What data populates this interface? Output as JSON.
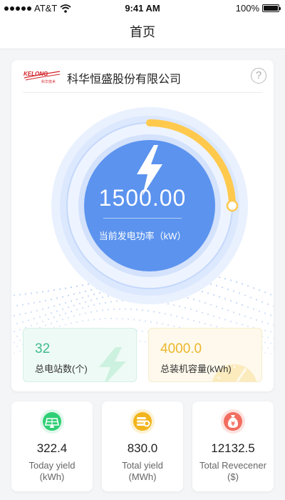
{
  "status_bar": {
    "carrier": "AT&T",
    "time": "9:41 AM",
    "battery": "100%",
    "battery_level": 1.0
  },
  "nav": {
    "title": "首页"
  },
  "company": {
    "name": "科华恒盛股份有限公司",
    "logo_text": "KELONG",
    "logo_subtext": "科华技术",
    "help_symbol": "?"
  },
  "power": {
    "value": "1500.00",
    "label": "当前发电功率（kW）",
    "gauge_level": 0.25
  },
  "stats": {
    "stations_value": "32",
    "stations_label": "总电站数(个)",
    "capacity_value": "4000.0",
    "capacity_label": "总装机容量(kWh)"
  },
  "cards": [
    {
      "value": "322.4",
      "label_line1": "Today yield",
      "label_line2": "(kWh)",
      "icon": "solar-panel-icon",
      "color": "#2fcf75"
    },
    {
      "value": "830.0",
      "label_line1": "Total yield",
      "label_line2": "(MWh)",
      "icon": "coin-stack-icon",
      "color": "#f2b51d"
    },
    {
      "value": "12132.5",
      "label_line1": "Total Revecener",
      "label_line2": "($)",
      "icon": "money-bag-icon",
      "color": "#f26d5f"
    }
  ],
  "colors": {
    "gauge_blue": "#5b93ee",
    "gauge_arc": "#ffc94d",
    "green": "#3fbb8e",
    "yellow": "#eab72c"
  }
}
